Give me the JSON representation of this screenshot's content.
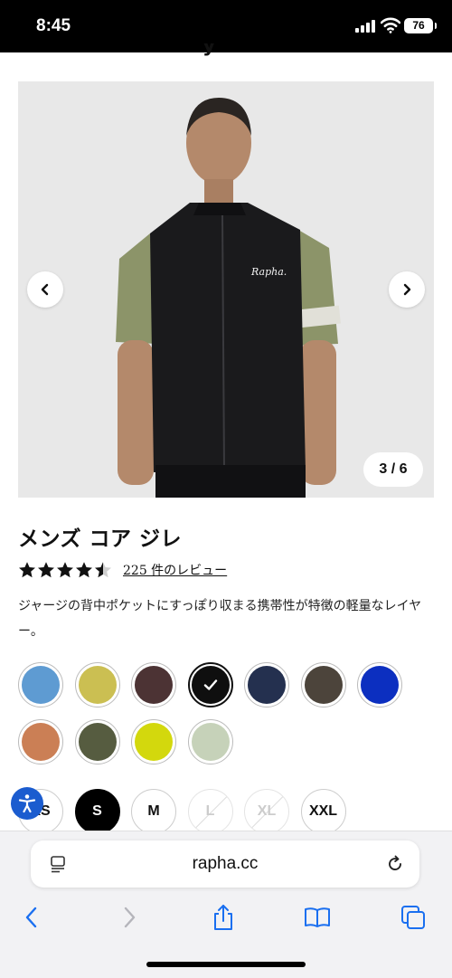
{
  "status_bar": {
    "time": "8:45",
    "battery": "76"
  },
  "product": {
    "image_counter": "3 / 6",
    "title": "メンズ コア ジレ",
    "rating": 4.5,
    "reviews_label": "225 件のレビュー",
    "description": "ジャージの背中ポケットにすっぽり収まる携帯性が特徴の軽量なレイヤー。"
  },
  "colors": [
    {
      "hex": "#5e9bd2",
      "selected": false
    },
    {
      "hex": "#cbbf52",
      "selected": false
    },
    {
      "hex": "#4c3334",
      "selected": false
    },
    {
      "hex": "#0f0f0f",
      "selected": true
    },
    {
      "hex": "#24304f",
      "selected": false
    },
    {
      "hex": "#4c443b",
      "selected": false
    },
    {
      "hex": "#0c2fc0",
      "selected": false
    },
    {
      "hex": "#cb7f55",
      "selected": false
    },
    {
      "hex": "#565c40",
      "selected": false
    },
    {
      "hex": "#d3d80d",
      "selected": false
    },
    {
      "hex": "#c6d2b9",
      "selected": false
    }
  ],
  "sizes": [
    {
      "label": "XS",
      "state": "available"
    },
    {
      "label": "S",
      "state": "selected"
    },
    {
      "label": "M",
      "state": "available"
    },
    {
      "label": "L",
      "state": "disabled"
    },
    {
      "label": "XL",
      "state": "disabled"
    },
    {
      "label": "XXL",
      "state": "available"
    }
  ],
  "browser": {
    "url": "rapha.cc"
  },
  "icons": {
    "prev": "chevron-left-icon",
    "next": "chevron-right-icon",
    "star": "star-icon",
    "check": "check-icon",
    "accessibility": "accessibility-icon",
    "reader": "reader-icon",
    "reload": "reload-icon",
    "back": "back-icon",
    "forward": "forward-icon",
    "share": "share-icon",
    "bookmarks": "bookmarks-icon",
    "tabs": "tabs-icon"
  },
  "accent_colors": {
    "accessibility": "#1b5ccf",
    "browser_tint": "#1a6ff0"
  }
}
